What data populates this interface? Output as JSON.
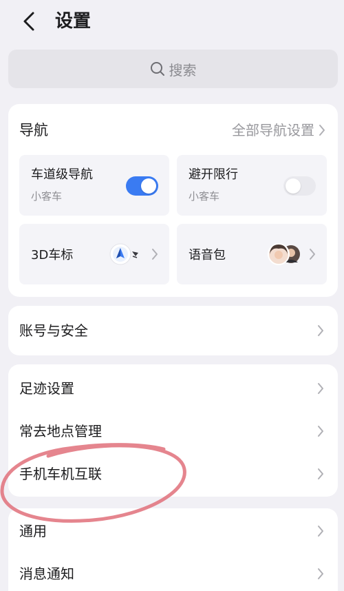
{
  "header": {
    "title": "设置"
  },
  "search": {
    "label": "搜索"
  },
  "navigation": {
    "title": "导航",
    "all_settings": "全部导航设置",
    "tiles": [
      {
        "title": "车道级导航",
        "subtitle": "小客车",
        "toggle_on": true
      },
      {
        "title": "避开限行",
        "subtitle": "小客车",
        "toggle_on": false
      },
      {
        "title": "3D车标",
        "icon": "car-3d-icon"
      },
      {
        "title": "语音包",
        "icon": "voice-avatars-icon"
      }
    ]
  },
  "account": {
    "label": "账号与安全"
  },
  "group2": {
    "items": [
      "足迹设置",
      "常去地点管理",
      "手机车机互联"
    ]
  },
  "group3": {
    "items": [
      "通用",
      "消息通知"
    ]
  },
  "colors": {
    "accent": "#3a7bf2",
    "annotation": "#e0707a",
    "background": "#f1f0f5"
  }
}
